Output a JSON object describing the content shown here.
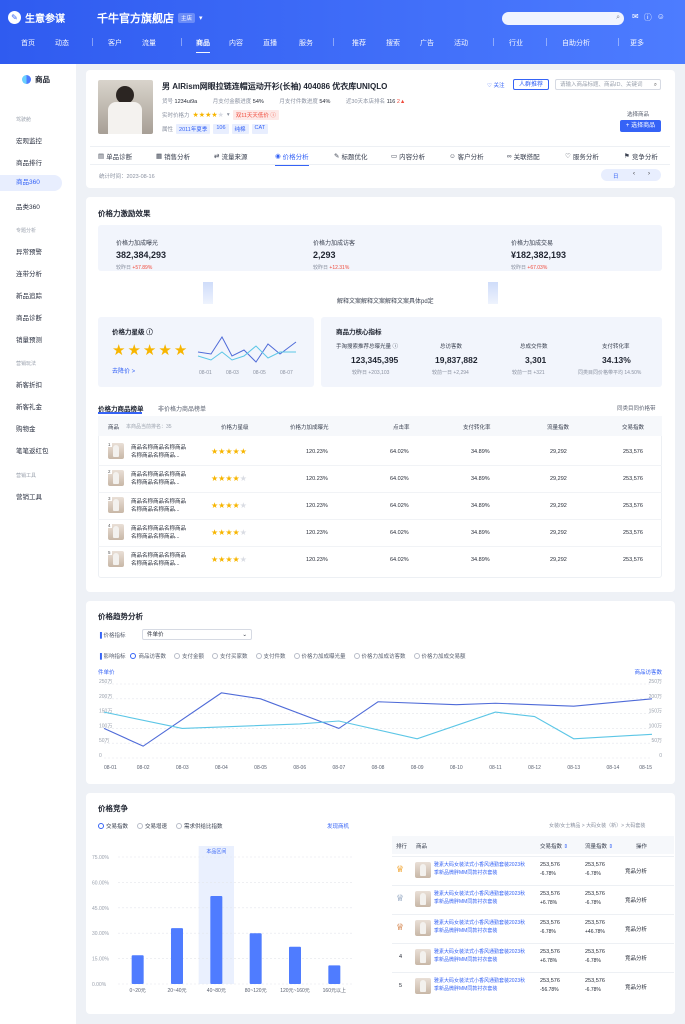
{
  "topbar": {
    "brand": "生意参谋",
    "shop_name": "千牛官方旗舰店",
    "shop_tag": "主店",
    "nav": [
      "首页",
      "动态",
      "客户",
      "流量",
      "商品",
      "内容",
      "直播",
      "服务",
      "推荐",
      "搜索",
      "广告",
      "活动",
      "行业",
      "自助分析",
      "更多"
    ],
    "nav_active": "商品"
  },
  "sidebar": {
    "title": "商品",
    "groups": [
      {
        "label": "驾驶舱",
        "items": [
          "宏观监控",
          "商品排行",
          "商品360",
          "品类360"
        ]
      },
      {
        "label": "专题分析",
        "items": [
          "异常预警",
          "连带分析",
          "新品追踪",
          "商品诊断",
          "销量预测"
        ]
      },
      {
        "label": "营销玩法",
        "items": [
          "新客折扣",
          "新客礼金",
          "购物金",
          "笔笔返红包"
        ]
      },
      {
        "label": "营销工具",
        "items": [
          "营销工具"
        ]
      }
    ],
    "active": "商品360"
  },
  "product": {
    "title": "男 AIRism网眼拉链连帽运动开衫(长袖) 404086 优衣库UNIQLO",
    "id_label": "货号",
    "id_value": "1234ui9a",
    "pay_rate_label": "月支付金额进度",
    "pay_rate_value": "54%",
    "pay_buyer_label": "月支付件数进度",
    "pay_buyer_value": "54%",
    "rank_label": "近30天本店排名",
    "rank_value": "116",
    "rank_change": "2▲",
    "price_power_label": "实时价格力",
    "price_badge": "双11天天低价 ⓘ",
    "attr_label": "属性",
    "attrs": [
      "2011年夏季",
      "106",
      "纯棉",
      "CAT"
    ],
    "follow": "关注",
    "add_btn": "人群推荐",
    "search_placeholder": "请输入商品标题、商品ID、关键词",
    "select_label": "选择商品",
    "select_btn": "+ 选择商品"
  },
  "tabs": [
    "单品诊断",
    "销售分析",
    "流量来源",
    "价格分析",
    "标题优化",
    "内容分析",
    "客户分析",
    "关联搭配",
    "服务分析",
    "竞争分析"
  ],
  "tab_active": "价格分析",
  "stat_date": "统计时间：2023-08-16",
  "period_btn": "日",
  "incentive": {
    "title": "价格力激励效果",
    "metrics": [
      {
        "label": "价格力加成曝光",
        "value": "382,384,293",
        "cmp": "较昨日",
        "change": "+57.89%"
      },
      {
        "label": "价格力加成访客",
        "value": "2,293",
        "cmp": "较昨日",
        "change": "+12.31%"
      },
      {
        "label": "价格力加成交易",
        "value": "¥182,382,193",
        "cmp": "较昨日",
        "change": "+67.03%"
      }
    ],
    "note": "解释文案解释文案解释文案具体pd定",
    "star_title": "价格力星级 ⓘ",
    "stars": 5,
    "star_link": "去降价 >",
    "spark_x": [
      "08-01",
      "08-03",
      "08-05",
      "08-07"
    ],
    "core_title": "商品力核心指标",
    "core": [
      {
        "label": "手淘搜索推荐总曝光量 ⓘ",
        "value": "123,345,395",
        "cmp": "较昨日 +203,103"
      },
      {
        "label": "总访客数",
        "value": "19,837,882",
        "cmp": "较前一日 +2,294"
      },
      {
        "label": "总成交件数",
        "value": "3,301",
        "cmp": "较前一日 +321"
      },
      {
        "label": "支付转化率",
        "value": "34.13%",
        "cmp": "同类目同价格带平均 14.50%"
      }
    ]
  },
  "ranking": {
    "tab1": "价格力商品榜单",
    "tab2": "非价格力商品榜单",
    "right_link": "同类目同价格带",
    "headers": [
      "商品",
      "本商品当前排名：35",
      "价格力星级",
      "价格力加成曝光",
      "点击率",
      "支付转化率",
      "流量指数",
      "交易指数"
    ],
    "rows": [
      {
        "rank": "1",
        "name": "商品名称商品名称商品名称商品名称商品...",
        "stars": 5,
        "exposure": "120.23%",
        "ctr": "64.02%",
        "cvr": "34.89%",
        "flow": "29,292",
        "trade": "253,576"
      },
      {
        "rank": "2",
        "name": "商品名称商品名称商品名称商品名称商品...",
        "stars": 4,
        "exposure": "120.23%",
        "ctr": "64.02%",
        "cvr": "34.89%",
        "flow": "29,292",
        "trade": "253,576"
      },
      {
        "rank": "3",
        "name": "商品名称商品名称商品名称商品名称商品...",
        "stars": 4,
        "exposure": "120.23%",
        "ctr": "64.02%",
        "cvr": "34.89%",
        "flow": "29,292",
        "trade": "253,576"
      },
      {
        "rank": "4",
        "name": "商品名称商品名称商品名称商品名称商品...",
        "stars": 4,
        "exposure": "120.23%",
        "ctr": "64.02%",
        "cvr": "34.89%",
        "flow": "29,292",
        "trade": "253,576"
      },
      {
        "rank": "5",
        "name": "商品名称商品名称商品名称商品名称商品...",
        "stars": 4,
        "exposure": "120.23%",
        "ctr": "64.02%",
        "cvr": "34.89%",
        "flow": "29,292",
        "trade": "253,576"
      }
    ]
  },
  "trend": {
    "title": "价格趋势分析",
    "price_label": "价格指标",
    "price_select": "件单价",
    "influence_label": "影响指标",
    "options": [
      "商品访客数",
      "支付金额",
      "支付买家数",
      "支付件数",
      "价格力加成曝光量",
      "价格力加成访客数",
      "价格力加成交易额"
    ],
    "option_active": "商品访客数",
    "left_axis_title": "件单价",
    "right_axis_title": "商品访客数"
  },
  "chart_data": [
    {
      "type": "line",
      "title": "",
      "x": [
        "08-01",
        "08-02",
        "08-03",
        "08-04",
        "08-05",
        "08-06",
        "08-07",
        "08-08",
        "08-09",
        "08-10",
        "08-11",
        "08-12",
        "08-13",
        "08-14",
        "08-15"
      ],
      "y_left_ticks": [
        "0",
        "50万",
        "100万",
        "150万",
        "200万",
        "250万"
      ],
      "y_right_ticks": [
        "0",
        "50万",
        "100万",
        "150万",
        "200万",
        "250万"
      ],
      "ylim": [
        0,
        250
      ],
      "series": [
        {
          "name": "件单价",
          "color": "#4f6bd8",
          "values": [
            100,
            40,
            null,
            220,
            200,
            null,
            100,
            190,
            null,
            180,
            185,
            null,
            175,
            null,
            200
          ]
        },
        {
          "name": "商品访客数",
          "color": "#5cc6e6",
          "values": [
            155,
            null,
            100,
            null,
            null,
            115,
            125,
            null,
            65,
            null,
            155,
            140,
            65,
            null,
            80
          ]
        }
      ]
    },
    {
      "type": "bar",
      "title": "",
      "categories": [
        "0~20元",
        "20~40元",
        "40~80元",
        "80~120元",
        "120元~160元",
        "160元以上"
      ],
      "values": [
        17,
        33,
        52,
        30,
        22,
        11
      ],
      "ylim": [
        0,
        75
      ],
      "y_ticks": [
        "0.00%",
        "15.00%",
        "30.00%",
        "45.00%",
        "60.00%",
        "75.00%"
      ],
      "highlight_label": "本品区间",
      "highlight_index": 2
    }
  ],
  "competition": {
    "title": "价格竞争",
    "options": [
      "交易指数",
      "交易增速",
      "需求供给比指数"
    ],
    "option_active": "交易指数",
    "link": "发现商机",
    "breadcrumb": "女装/女士精品 > 大码女装（新）> 大码套装",
    "headers": [
      "排行",
      "商品",
      "交易指数",
      "流量指数",
      "操作"
    ],
    "rows": [
      {
        "rank": "1",
        "name": "雅素大码女装法式小香风通勤套装2023秋季新品微胖MM同款衬衣套装",
        "trade": "253,576",
        "trade_chg": "-6.78%",
        "flow": "253,576",
        "flow_chg": "-6.78%",
        "op": "竞品分析"
      },
      {
        "rank": "2",
        "name": "雅素大码女装法式小香风通勤套装2023秋季新品微胖MM同款衬衣套装",
        "trade": "253,576",
        "trade_chg": "+6.78%",
        "flow": "253,576",
        "flow_chg": "-6.78%",
        "op": "竞品分析"
      },
      {
        "rank": "3",
        "name": "雅素大码女装法式小香风通勤套装2023秋季新品微胖MM同款衬衣套装",
        "trade": "253,576",
        "trade_chg": "-6.78%",
        "flow": "253,576",
        "flow_chg": "+46.78%",
        "op": "竞品分析"
      },
      {
        "rank": "4",
        "name": "雅素大码女装法式小香风通勤套装2023秋季新品微胖MM同款衬衣套装",
        "trade": "253,576",
        "trade_chg": "+6.78%",
        "flow": "253,576",
        "flow_chg": "-6.78%",
        "op": "竞品分析"
      },
      {
        "rank": "5",
        "name": "雅素大码女装法式小香风通勤套装2023秋季新品微胖MM同款衬衣套装",
        "trade": "253,576",
        "trade_chg": "-56.78%",
        "flow": "253,576",
        "flow_chg": "-6.78%",
        "op": "竞品分析"
      }
    ]
  }
}
